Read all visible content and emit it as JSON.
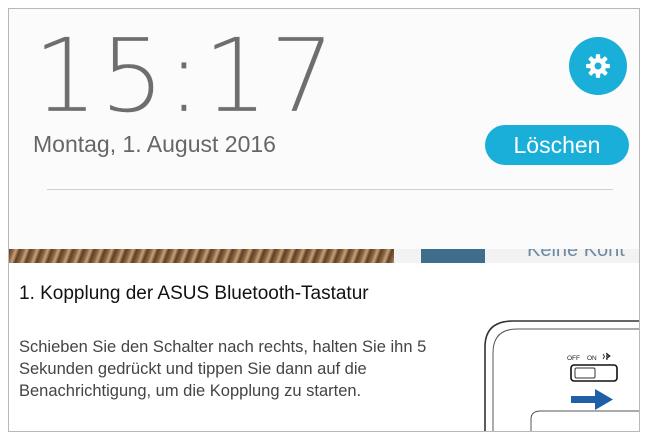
{
  "lockscreen": {
    "time": "15:17",
    "date": "Montag, 1. August 2016",
    "clear_label": "Löschen",
    "settings_icon": "gear-icon"
  },
  "background_peek": {
    "text": "Keine Kont"
  },
  "notification": {
    "title": "1. Kopplung der ASUS Bluetooth-Tastatur",
    "body": "Schieben Sie den Schalter nach rechts, halten Sie ihn 5 Sekunden gedrückt und tippen Sie dann auf die Benachrichtigung, um die Kopplung zu starten.",
    "image": {
      "switch_label_off": "OFF",
      "switch_label_on": "ON",
      "bluetooth_icon": "bluetooth-icon",
      "arrow_icon": "arrow-right-icon"
    }
  },
  "colors": {
    "accent": "#1aafd8",
    "arrow": "#1f5fa8"
  }
}
